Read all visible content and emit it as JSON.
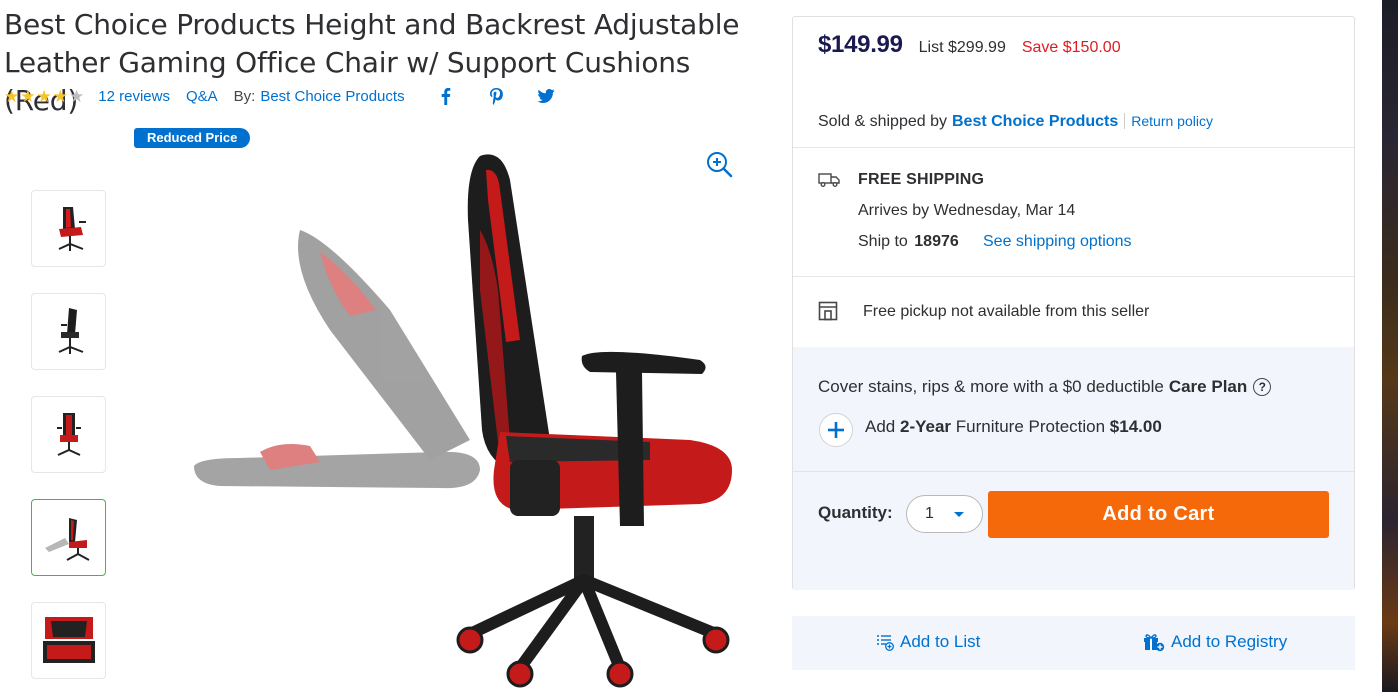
{
  "product": {
    "title": "Best Choice Products Height and Backrest Adjustable Leather Gaming Office Chair w/ Support Cushions (Red)",
    "rating": 4,
    "rating_max": 5,
    "reviews": "12 reviews",
    "qa": "Q&A",
    "by_label": "By:",
    "brand": "Best Choice Products",
    "badge": "Reduced Price"
  },
  "social": {
    "facebook": "facebook-icon",
    "pinterest": "pinterest-icon",
    "twitter": "twitter-icon"
  },
  "thumbnails": [
    "front-left view",
    "rear view",
    "front view",
    "recline view",
    "detail view"
  ],
  "active_thumbnail": 3,
  "offer": {
    "price": "$149.99",
    "list": "List $299.99",
    "save": "Save $150.00",
    "sold_label": "Sold & shipped by",
    "seller": "Best Choice Products",
    "return_policy": "Return policy"
  },
  "shipping": {
    "title": "FREE SHIPPING",
    "arrives": "Arrives by Wednesday, Mar 14",
    "ship_to_label": "Ship to",
    "zip": "18976",
    "options_link": "See shipping options"
  },
  "pickup": {
    "text": "Free pickup not available from this seller"
  },
  "care": {
    "prefix": "Cover stains, rips & more with a $0 deductible",
    "plan": "Care Plan",
    "add": "Add",
    "years": "2-Year",
    "protection": "Furniture Protection",
    "price": "$14.00"
  },
  "purchase": {
    "quantity_label": "Quantity:",
    "quantity": "1",
    "add_to_cart": "Add to Cart"
  },
  "actions": {
    "add_to_list": "Add to List",
    "add_to_registry": "Add to Registry"
  },
  "colors": {
    "accent": "#0071ce",
    "cart": "#f6690b",
    "save": "#de1c24",
    "star": "#f8c22b",
    "price": "#1a1a50"
  }
}
